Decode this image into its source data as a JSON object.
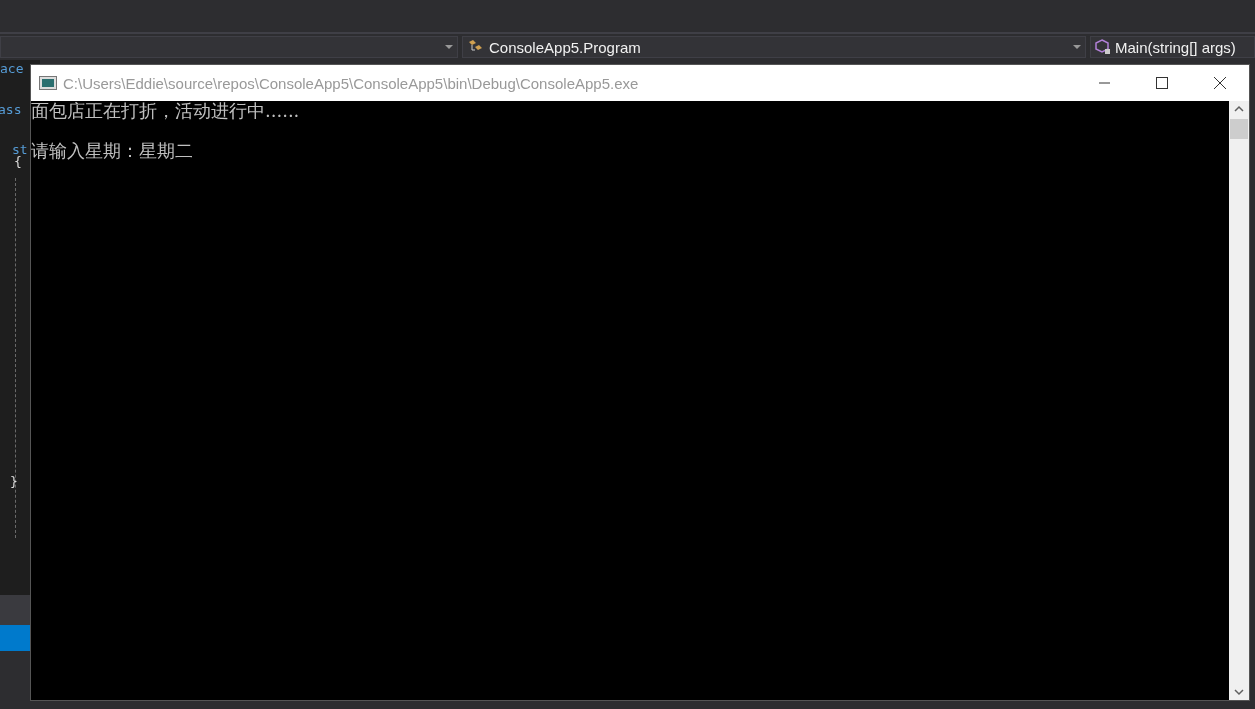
{
  "navigation_bar": {
    "class_dropdown": "ConsoleApp5.Program",
    "member_dropdown": "Main(string[] args)"
  },
  "editor": {
    "code_fragments": [
      {
        "text": "ace",
        "kind": "keyword"
      },
      {
        "text": "ass",
        "kind": "keyword"
      },
      {
        "text": "st",
        "kind": "keyword"
      },
      {
        "text": "{",
        "kind": "brace"
      },
      {
        "text": "}",
        "kind": "brace"
      }
    ]
  },
  "console_window": {
    "title": "C:\\Users\\Eddie\\source\\repos\\ConsoleApp5\\ConsoleApp5\\bin\\Debug\\ConsoleApp5.exe",
    "lines": [
      "面包店正在打折，活动进行中......",
      "请输入星期：星期二"
    ]
  }
}
